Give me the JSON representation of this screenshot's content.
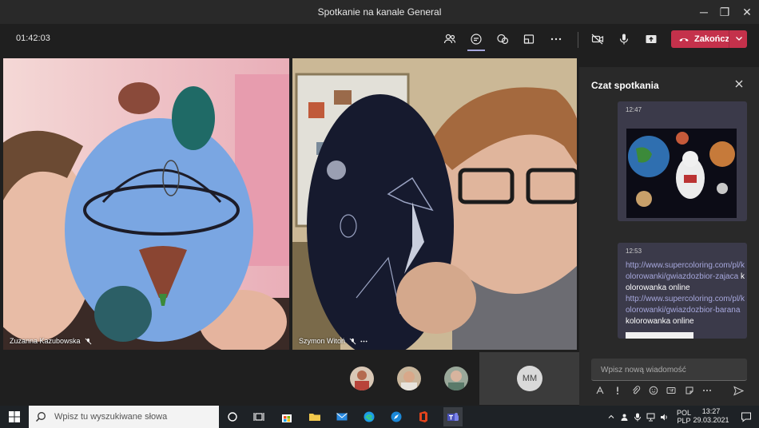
{
  "window": {
    "title": "Spotkanie na kanale General",
    "minimize": "─",
    "maximize": "❐",
    "close": "✕"
  },
  "meeting": {
    "timer": "01:42:03",
    "end_label": "Zakończ"
  },
  "participants": {
    "tile1_name": "Zuzanna Kazubowska",
    "tile2_name": "Szymon Witoń",
    "mm_initials": "MM"
  },
  "chat": {
    "title": "Czat spotkania",
    "msg1_time": "12:47",
    "msg2_time": "12:53",
    "msg2_link1": "http://www.supercoloring.com/pl/kolorowanki/gwiazdozbior-zajaca",
    "msg2_text1": " kolorowanka online",
    "msg2_link2": "http://www.supercoloring.com/pl/kolorowanki/gwiazdozbior-barana",
    "msg2_text2": " kolorowanka online",
    "compose_placeholder": "Wpisz nową wiadomość"
  },
  "taskbar": {
    "search_placeholder": "Wpisz tu wyszukiwane słowa",
    "lang_top": "POL",
    "lang_bottom": "PLP",
    "time": "13:27",
    "date": "29.03.2021"
  },
  "colors": {
    "accent": "#a6a7dc",
    "end_button": "#c4314b",
    "panel_bg": "#292929",
    "stage_bg": "#1f1f1f"
  }
}
